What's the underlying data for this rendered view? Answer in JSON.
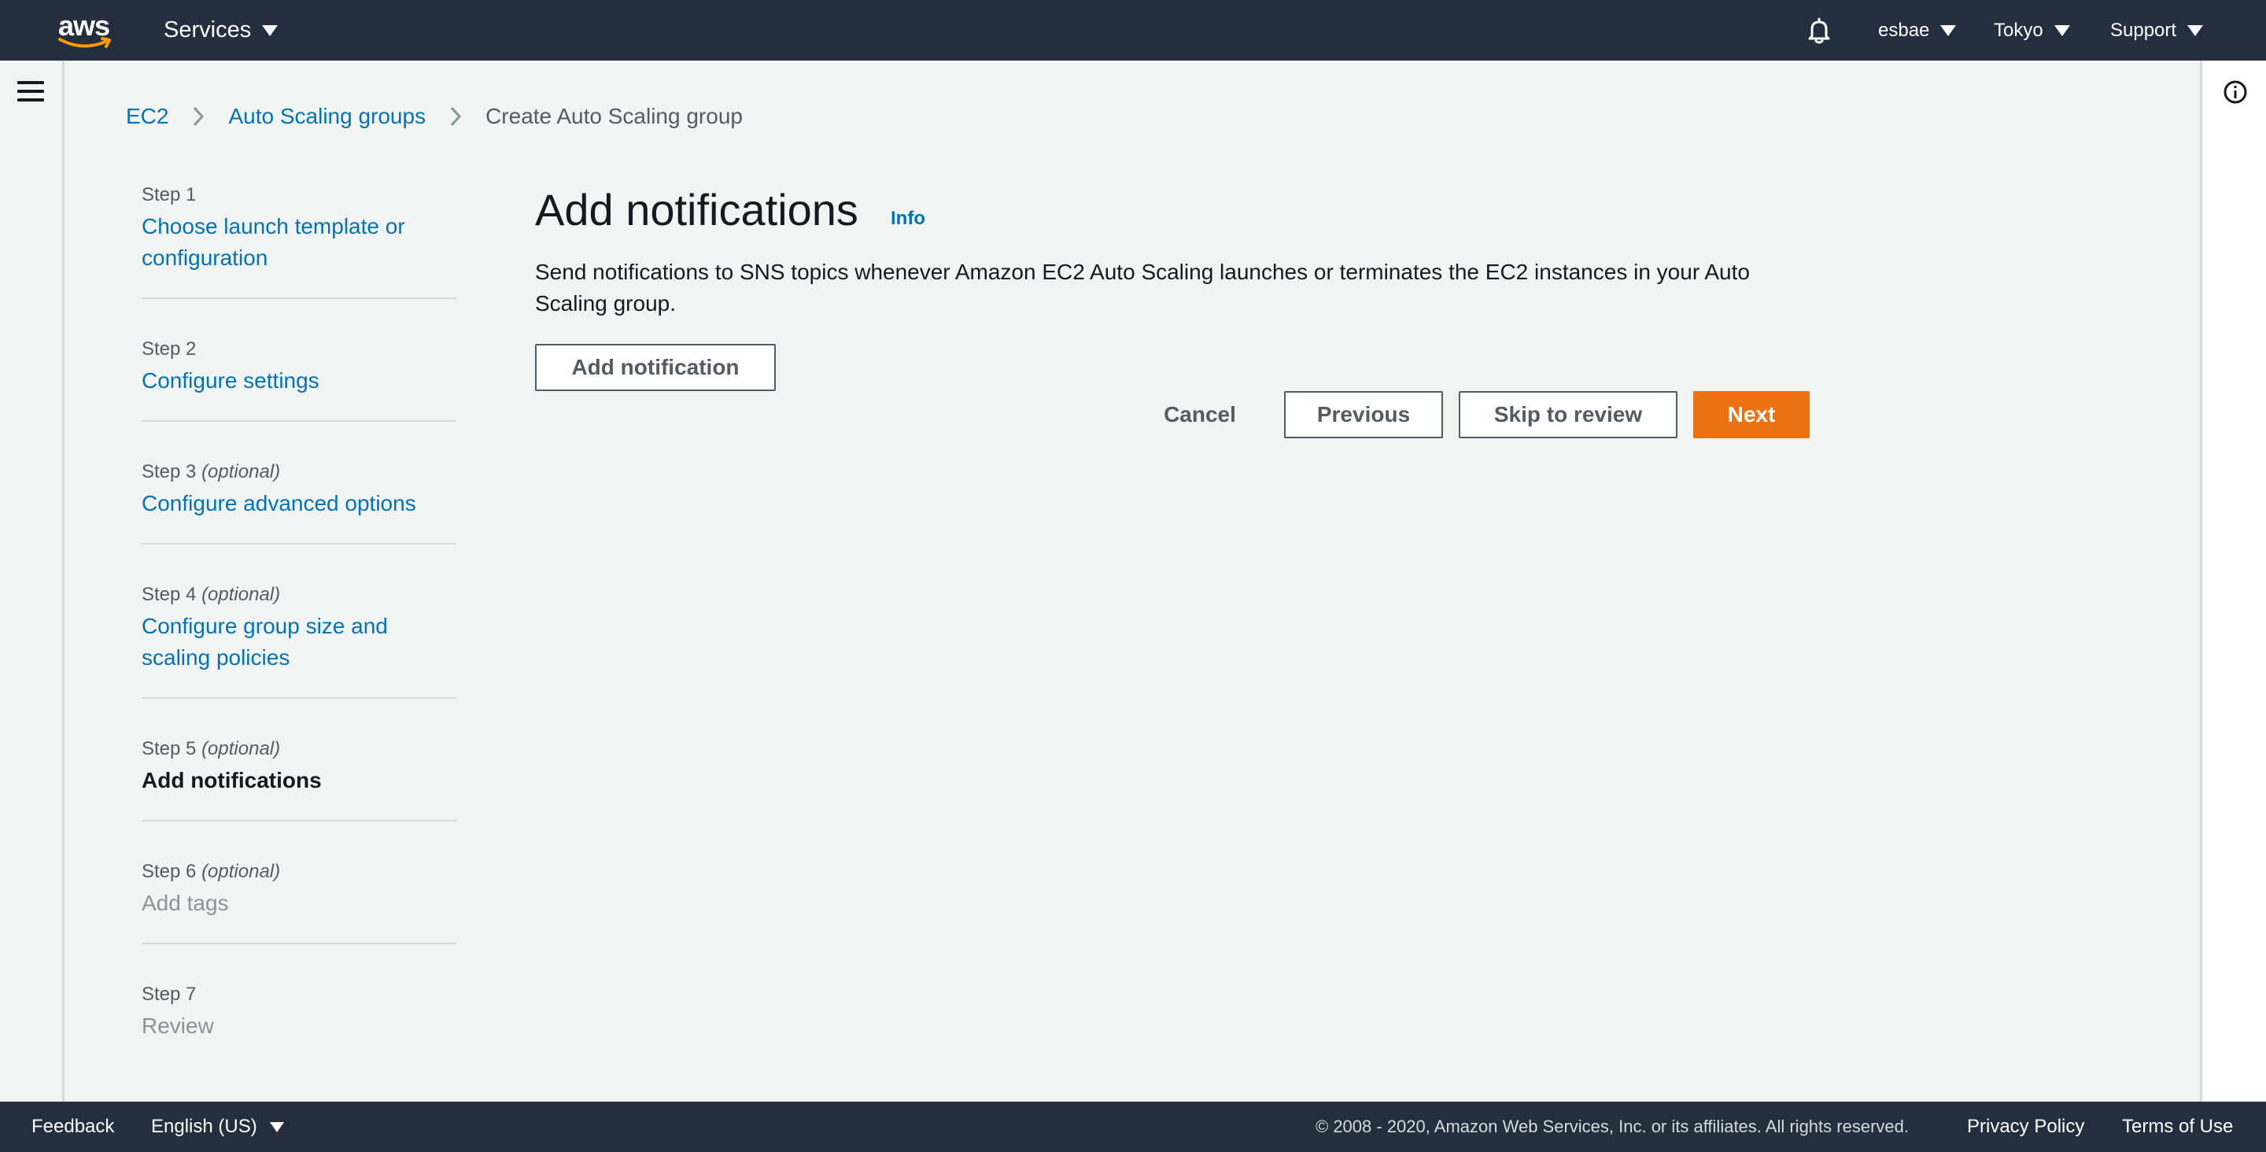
{
  "topnav": {
    "logo_text": "aws",
    "services_label": "Services",
    "bell_icon": "notification-bell-icon",
    "user_label": "esbae",
    "region_label": "Tokyo",
    "support_label": "Support"
  },
  "breadcrumb": {
    "items": [
      "EC2",
      "Auto Scaling groups"
    ],
    "current": "Create Auto Scaling group"
  },
  "steps": [
    {
      "number": "Step 1",
      "optional": "",
      "title": "Choose launch template or configuration",
      "state": "link"
    },
    {
      "number": "Step 2",
      "optional": "",
      "title": "Configure settings",
      "state": "link"
    },
    {
      "number": "Step 3",
      "optional": "(optional)",
      "title": "Configure advanced options",
      "state": "link"
    },
    {
      "number": "Step 4",
      "optional": "(optional)",
      "title": "Configure group size and scaling policies",
      "state": "link"
    },
    {
      "number": "Step 5",
      "optional": "(optional)",
      "title": "Add notifications",
      "state": "active"
    },
    {
      "number": "Step 6",
      "optional": "(optional)",
      "title": "Add tags",
      "state": "disabled"
    },
    {
      "number": "Step 7",
      "optional": "",
      "title": "Review",
      "state": "disabled"
    }
  ],
  "main": {
    "title": "Add notifications",
    "info_label": "Info",
    "description": "Send notifications to SNS topics whenever Amazon EC2 Auto Scaling launches or terminates the EC2 instances in your Auto Scaling group.",
    "add_notification_label": "Add notification",
    "cancel_label": "Cancel",
    "previous_label": "Previous",
    "skip_label": "Skip to review",
    "next_label": "Next"
  },
  "footer": {
    "feedback_label": "Feedback",
    "language_label": "English (US)",
    "copyright": "© 2008 - 2020, Amazon Web Services, Inc. or its affiliates. All rights reserved.",
    "privacy_label": "Privacy Policy",
    "terms_label": "Terms of Use"
  },
  "colors": {
    "nav_bg": "#232f3e",
    "link": "#0073bb",
    "primary": "#ec7211",
    "page_bg": "#f2f3f3"
  }
}
